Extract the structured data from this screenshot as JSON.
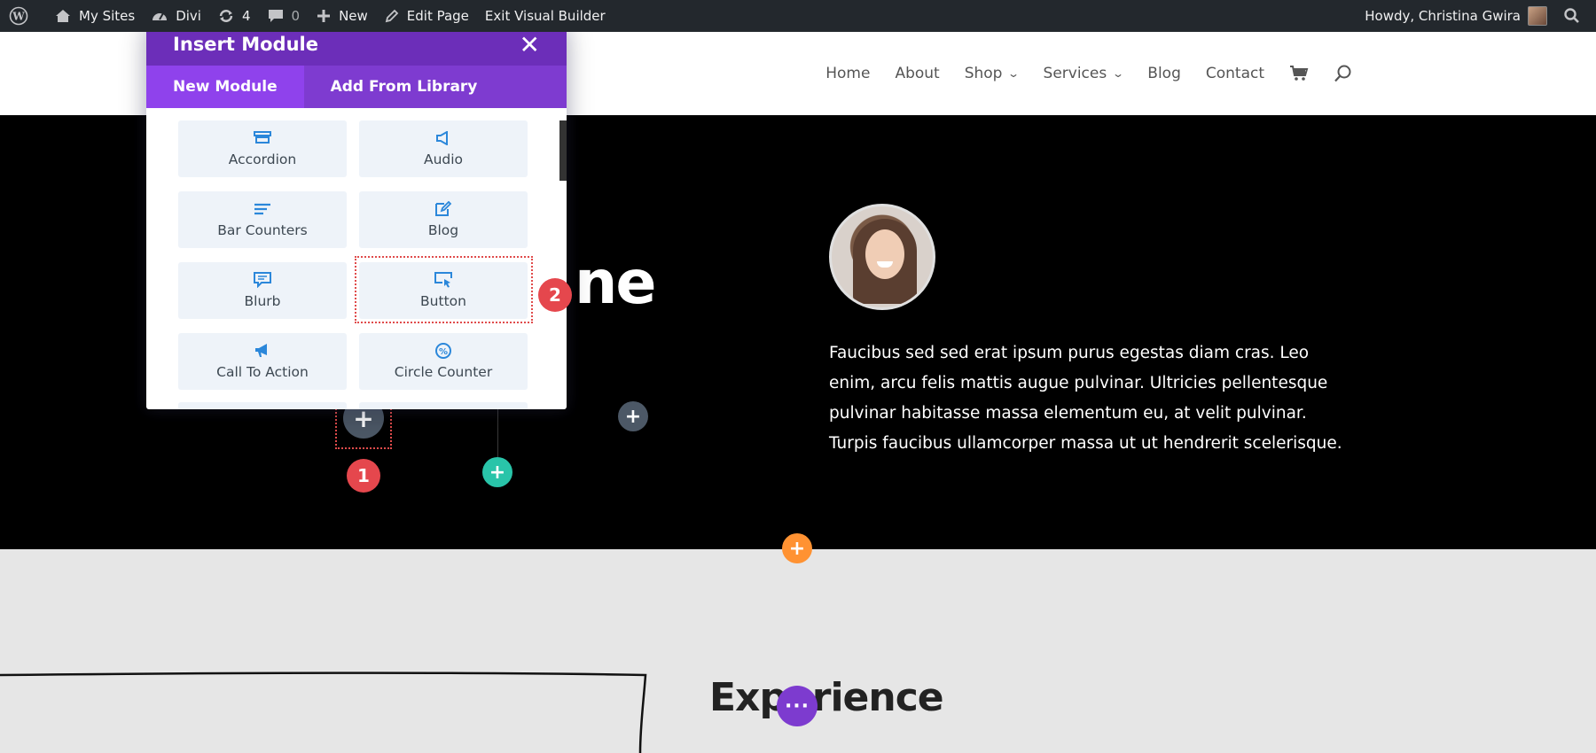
{
  "admin_bar": {
    "my_sites": "My Sites",
    "divi": "Divi",
    "updates_count": "4",
    "comments_count": "0",
    "new": "New",
    "edit_page": "Edit Page",
    "exit_builder": "Exit Visual Builder",
    "greeting": "Howdy, Christina Gwira"
  },
  "nav": {
    "items": [
      {
        "label": "Home"
      },
      {
        "label": "About"
      },
      {
        "label": "Shop"
      },
      {
        "label": "Services"
      },
      {
        "label": "Blog"
      },
      {
        "label": "Contact"
      }
    ]
  },
  "hero": {
    "title_fragment": "ne",
    "paragraph": "Faucibus sed sed erat ipsum purus egestas diam cras. Leo enim, arcu felis mattis augue pulvinar. Ultricies pellentesque pulvinar habitasse massa elementum eu, at velit pulvinar. Turpis faucibus ullamcorper massa ut ut hendrerit scelerisque."
  },
  "modal": {
    "title": "Insert Module",
    "tabs": [
      {
        "label": "New Module"
      },
      {
        "label": "Add From Library"
      }
    ],
    "modules": [
      {
        "label": "Accordion",
        "icon": "accordion-icon"
      },
      {
        "label": "Audio",
        "icon": "audio-icon"
      },
      {
        "label": "Bar Counters",
        "icon": "bar-counters-icon"
      },
      {
        "label": "Blog",
        "icon": "blog-icon"
      },
      {
        "label": "Blurb",
        "icon": "blurb-icon"
      },
      {
        "label": "Button",
        "icon": "button-icon"
      },
      {
        "label": "Call To Action",
        "icon": "call-to-action-icon"
      },
      {
        "label": "Circle Counter",
        "icon": "circle-counter-icon"
      }
    ]
  },
  "annotations": {
    "step1": "1",
    "step2": "2"
  },
  "buttons": {
    "plus": "+",
    "more": "···"
  },
  "section2": {
    "title": "Experience"
  },
  "colors": {
    "admin_bar": "#23282d",
    "modal_header": "#6c2eb9",
    "tab_active": "#8f42ec",
    "module_icon": "#2b87da",
    "badge": "#e5474d",
    "add_green": "#29c4a9",
    "add_orange": "#ff9232",
    "dots_purple": "#7d3bcf"
  }
}
